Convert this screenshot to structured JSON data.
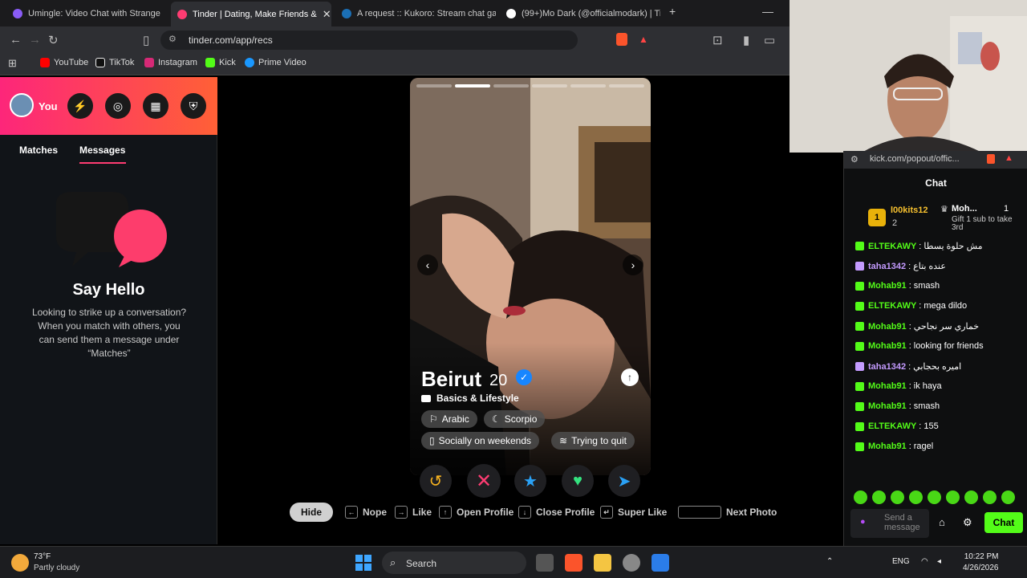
{
  "browser": {
    "tabs": [
      {
        "title": "Umingle: Video Chat with Strange",
        "color": "#8a5cf6",
        "active": false
      },
      {
        "title": "Tinder | Dating, Make Friends &",
        "color": "#fe3c72",
        "active": true
      },
      {
        "title": "A request :: Kukoro: Stream chat gam",
        "color": "#1b6fb5",
        "active": false
      },
      {
        "title": "(99+)Mo Dark (@officialmodark) | Ti",
        "color": "#111111",
        "active": false
      }
    ],
    "url": "tinder.com/app/recs",
    "bookmarks": [
      "YouTube",
      "TikTok",
      "Instagram",
      "Kick",
      "Prime Video"
    ]
  },
  "sidebar": {
    "you_label": "You",
    "tabs": [
      "Matches",
      "Messages"
    ],
    "say_hello_title": "Say Hello",
    "say_hello_text": "Looking to strike up a conversation? When you match with others, you can send them a message under “Matches”"
  },
  "profile": {
    "name": "Beirut",
    "age": "20",
    "basics_label": "Basics & Lifestyle",
    "chips": [
      "Arabic",
      "Scorpio",
      "Socially on weekends",
      "Trying to quit"
    ],
    "photo_count": 6,
    "current_photo": 2
  },
  "hints": [
    {
      "key": "",
      "label": "Hide"
    },
    {
      "key": "←",
      "label": "Nope"
    },
    {
      "key": "→",
      "label": "Like"
    },
    {
      "key": "↑",
      "label": "Open Profile"
    },
    {
      "key": "↓",
      "label": "Close Profile"
    },
    {
      "key": "↵",
      "label": "Super Like"
    },
    {
      "key": "",
      "label": "Next Photo"
    }
  ],
  "chat": {
    "url": "kick.com/popout/offic...",
    "title": "Chat",
    "top_gifter": {
      "name": "l00kits12",
      "rank": "1",
      "count": "2"
    },
    "second_gifter": {
      "name": "Moh...",
      "count": "1",
      "note": "Gift 1 sub to take 3rd"
    },
    "messages": [
      {
        "user": "ELTEKAWY",
        "text": "مش حلوة يسطا",
        "color": "#53fc18"
      },
      {
        "user": "taha1342",
        "text": "عنده بتاع",
        "color": "#c49bff"
      },
      {
        "user": "Mohab91",
        "text": "smash",
        "color": "#53fc18"
      },
      {
        "user": "ELTEKAWY",
        "text": "mega dildo",
        "color": "#53fc18"
      },
      {
        "user": "Mohab91",
        "text": "خماري سر نجاحي",
        "color": "#53fc18"
      },
      {
        "user": "Mohab91",
        "text": "looking for friends",
        "color": "#53fc18"
      },
      {
        "user": "taha1342",
        "text": "اميره بحجابي",
        "color": "#c49bff"
      },
      {
        "user": "Mohab91",
        "text": "ik haya",
        "color": "#53fc18"
      },
      {
        "user": "Mohab91",
        "text": "smash",
        "color": "#53fc18"
      },
      {
        "user": "ELTEKAWY",
        "text": "155",
        "color": "#53fc18"
      },
      {
        "user": "Mohab91",
        "text": "ragel",
        "color": "#53fc18"
      }
    ],
    "input_placeholder": "Send a message",
    "send_label": "Chat"
  },
  "taskbar": {
    "temp": "73°F",
    "weather": "Partly cloudy",
    "search_label": "Search",
    "lang": "ENG",
    "time": "10:22 PM",
    "date": "4/26/2026"
  },
  "colors": {
    "tinder_pink": "#fe3c72",
    "kick_green": "#53fc18"
  }
}
